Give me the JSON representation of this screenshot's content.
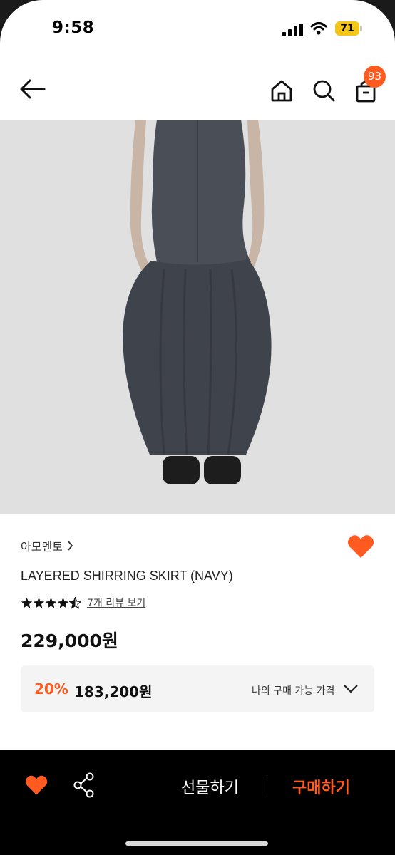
{
  "status_bar": {
    "time": "9:58",
    "battery": "71"
  },
  "header": {
    "cart_count": "93"
  },
  "product": {
    "brand": "아모멘토",
    "title": "LAYERED SHIRRING SKIRT (NAVY)",
    "rating": 4.5,
    "review_link": "7개 리뷰 보기",
    "price": "229,000원",
    "discount_percent": "20%",
    "discount_price": "183,200원",
    "discount_label": "나의 구매 가능 가격"
  },
  "bottom_bar": {
    "gift_label": "선물하기",
    "buy_label": "구매하기"
  },
  "colors": {
    "accent": "#ff5a1f",
    "bottom_bg": "#000000"
  }
}
